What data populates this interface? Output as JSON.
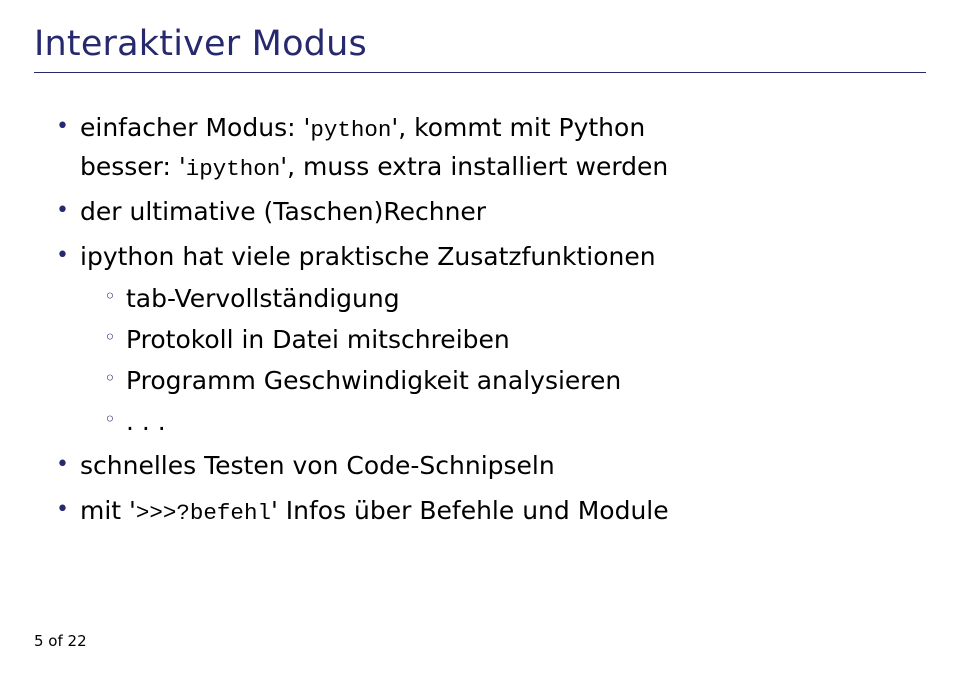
{
  "title": "Interaktiver Modus",
  "bullets": {
    "b1_pre": "einfacher Modus: '",
    "b1_code1": "python",
    "b1_post": "', kommt mit Python",
    "b1_line2_pre": "besser: '",
    "b1_line2_code": "ipython",
    "b1_line2_post": "', muss extra installiert werden",
    "b2": "der ultimative (Taschen)Rechner",
    "b3": "ipython hat viele praktische Zusatzfunktionen",
    "b3_sub1": "tab-Vervollständigung",
    "b3_sub2": "Protokoll in Datei mitschreiben",
    "b3_sub3": "Programm Geschwindigkeit analysieren",
    "b3_sub4": ". . .",
    "b4": "schnelles Testen von Code-Schnipseln",
    "b5_pre": "mit '",
    "b5_code": ">>>?befehl",
    "b5_post": "' Infos über Befehle und Module"
  },
  "page": "5 of 22"
}
